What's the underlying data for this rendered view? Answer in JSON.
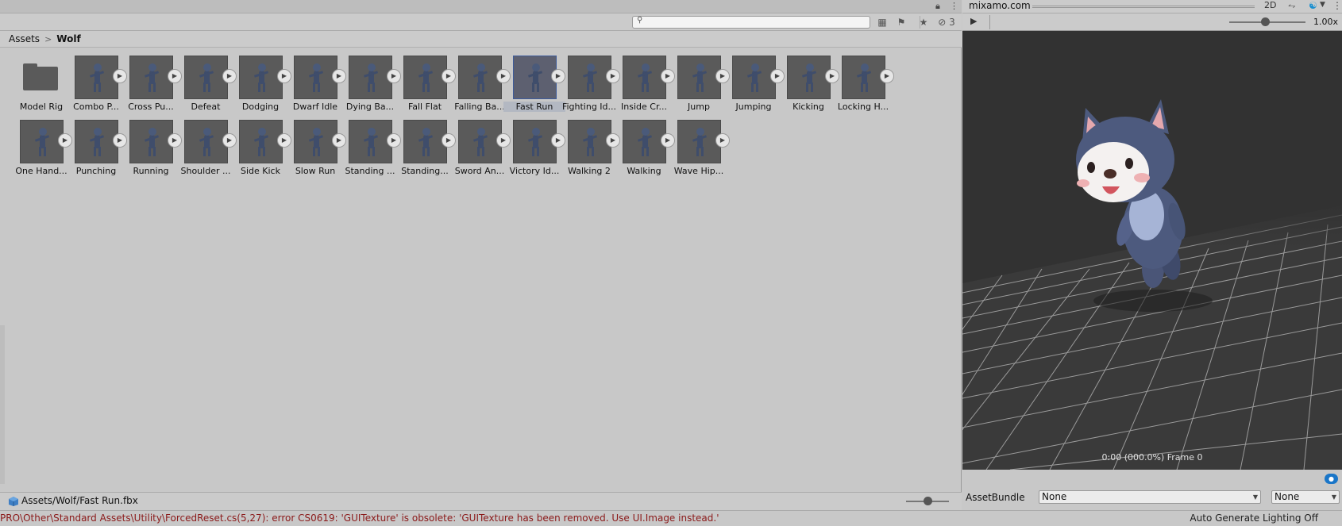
{
  "tabstrip": {
    "lock_icon": "lock-icon",
    "more_icon": "kebab-menu-icon"
  },
  "toolbar": {
    "search": {
      "value": "",
      "placeholder": ""
    },
    "hidden_count": "3",
    "icons": [
      "search-by-type-icon",
      "label-icon",
      "favorite-star-icon",
      "hidden-packages-eye-icon"
    ]
  },
  "breadcrumb": {
    "root": "Assets",
    "separator": ">",
    "current": "Wolf"
  },
  "assets": {
    "row1": [
      {
        "label": "Model Rig",
        "type": "folder"
      },
      {
        "label": "Combo P...",
        "type": "animation"
      },
      {
        "label": "Cross Pu...",
        "type": "animation"
      },
      {
        "label": "Defeat",
        "type": "animation"
      },
      {
        "label": "Dodging",
        "type": "animation"
      },
      {
        "label": "Dwarf Idle",
        "type": "animation"
      },
      {
        "label": "Dying Ba...",
        "type": "animation"
      },
      {
        "label": "Fall Flat",
        "type": "animation"
      },
      {
        "label": "Falling Ba...",
        "type": "animation"
      },
      {
        "label": "Fast Run",
        "type": "animation",
        "selected": true
      },
      {
        "label": "Fighting Id...",
        "type": "animation"
      },
      {
        "label": "Inside Cr...",
        "type": "animation"
      },
      {
        "label": "Jump",
        "type": "animation"
      },
      {
        "label": "Jumping",
        "type": "animation"
      },
      {
        "label": "Kicking",
        "type": "animation"
      },
      {
        "label": "Locking H...",
        "type": "animation"
      }
    ],
    "row2": [
      {
        "label": "One Hand...",
        "type": "animation"
      },
      {
        "label": "Punching",
        "type": "animation"
      },
      {
        "label": "Running",
        "type": "animation"
      },
      {
        "label": "Shoulder ...",
        "type": "animation"
      },
      {
        "label": "Side Kick",
        "type": "animation"
      },
      {
        "label": "Slow Run",
        "type": "animation"
      },
      {
        "label": "Standing ...",
        "type": "animation"
      },
      {
        "label": "Standing...",
        "type": "animation"
      },
      {
        "label": "Sword An...",
        "type": "animation"
      },
      {
        "label": "Victory Id...",
        "type": "animation"
      },
      {
        "label": "Walking 2",
        "type": "animation"
      },
      {
        "label": "Walking",
        "type": "animation"
      },
      {
        "label": "Wave Hip...",
        "type": "animation"
      }
    ]
  },
  "statusbar": {
    "path": "Assets/Wolf/Fast Run.fbx",
    "zoom_level": 0.5
  },
  "preview": {
    "title": "mixamo.com",
    "btn_2d": "2D",
    "speed": "1.00x",
    "speed_level": 0.47,
    "frame_info": "0:00 (000.0%) Frame 0",
    "background_color": "#323232"
  },
  "asset_bundle": {
    "label": "AssetBundle",
    "bundle": "None",
    "variant": "None"
  },
  "console": {
    "message": "PRO\\Other\\Standard Assets\\Utility\\ForcedReset.cs(5,27): error CS0619: 'GUITexture' is obsolete: 'GUITexture has been removed. Use UI.Image instead.'",
    "message_color": "#8b1a1a",
    "lighting_status": "Auto Generate Lighting Off"
  }
}
